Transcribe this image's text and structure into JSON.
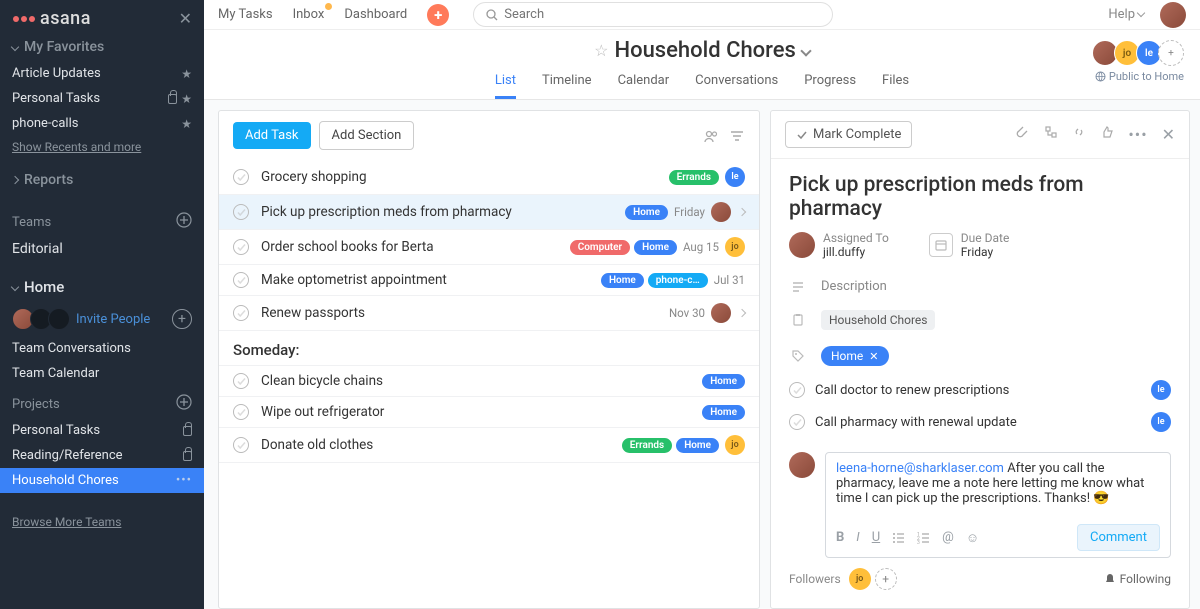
{
  "brand": "asana",
  "topnav": {
    "my_tasks": "My Tasks",
    "inbox": "Inbox",
    "dashboard": "Dashboard",
    "search_placeholder": "Search",
    "help": "Help"
  },
  "sidebar": {
    "favorites_title": "My Favorites",
    "favorites": [
      {
        "label": "Article Updates"
      },
      {
        "label": "Personal Tasks"
      },
      {
        "label": "phone-calls"
      }
    ],
    "show_recents": "Show Recents and more",
    "reports": "Reports",
    "teams": "Teams",
    "editorial": "Editorial",
    "home": "Home",
    "invite": "Invite People",
    "team_convos": "Team Conversations",
    "team_calendar": "Team Calendar",
    "projects": "Projects",
    "project_items": [
      {
        "label": "Personal Tasks"
      },
      {
        "label": "Reading/Reference"
      },
      {
        "label": "Household Chores"
      }
    ],
    "browse_teams": "Browse More Teams"
  },
  "project": {
    "title": "Household Chores",
    "public_label": "Public to Home",
    "tabs": [
      "List",
      "Timeline",
      "Calendar",
      "Conversations",
      "Progress",
      "Files"
    ],
    "members": [
      "",
      "jo",
      "le"
    ]
  },
  "list_toolbar": {
    "add_task": "Add Task",
    "add_section": "Add Section"
  },
  "tasks": [
    {
      "title": "Grocery shopping",
      "pills": [
        {
          "label": "Errands",
          "cls": "errands"
        }
      ],
      "assignee": {
        "txt": "le",
        "cls": "le"
      }
    },
    {
      "title": "Pick up prescription meds from pharmacy",
      "pills": [
        {
          "label": "Home",
          "cls": "home"
        }
      ],
      "date": "Friday",
      "assignee": {
        "txt": "",
        "cls": "ph"
      },
      "selected": true,
      "chev": true
    },
    {
      "title": "Order school books for Berta",
      "pills": [
        {
          "label": "Computer",
          "cls": "computer"
        },
        {
          "label": "Home",
          "cls": "home"
        }
      ],
      "date": "Aug 15",
      "assignee": {
        "txt": "jo",
        "cls": "jo"
      }
    },
    {
      "title": "Make optometrist appointment",
      "pills": [
        {
          "label": "Home",
          "cls": "home"
        },
        {
          "label": "phone-c…",
          "cls": "phonec"
        }
      ],
      "date": "Jul 31"
    },
    {
      "title": "Renew passports",
      "date": "Nov 30",
      "assignee": {
        "txt": "",
        "cls": "ph"
      },
      "chev": true
    }
  ],
  "section_someday": "Someday:",
  "someday_tasks": [
    {
      "title": "Clean bicycle chains",
      "pills": [
        {
          "label": "Home",
          "cls": "home"
        }
      ]
    },
    {
      "title": "Wipe out refrigerator",
      "pills": [
        {
          "label": "Home",
          "cls": "home"
        }
      ]
    },
    {
      "title": "Donate old clothes",
      "pills": [
        {
          "label": "Errands",
          "cls": "errands"
        },
        {
          "label": "Home",
          "cls": "home"
        }
      ],
      "assignee": {
        "txt": "jo",
        "cls": "jo"
      }
    }
  ],
  "detail": {
    "mark_complete": "Mark Complete",
    "title": "Pick up prescription meds from pharmacy",
    "assigned_label": "Assigned To",
    "assigned_value": "jill.duffy",
    "due_label": "Due Date",
    "due_value": "Friday",
    "description_placeholder": "Description",
    "project_chip": "Household Chores",
    "tag": "Home",
    "subtasks": [
      {
        "title": "Call doctor to renew prescriptions",
        "assignee": {
          "txt": "le",
          "cls": "le"
        }
      },
      {
        "title": "Call pharmacy with renewal update",
        "assignee": {
          "txt": "le",
          "cls": "le"
        }
      }
    ],
    "comment_mention": "leena-horne@sharklaser.com",
    "comment_body": " After you call the pharmacy, leave me a note here letting me know what time I can pick up the prescriptions. Thanks! 😎",
    "comment_button": "Comment",
    "followers_label": "Followers",
    "following_label": "Following"
  }
}
